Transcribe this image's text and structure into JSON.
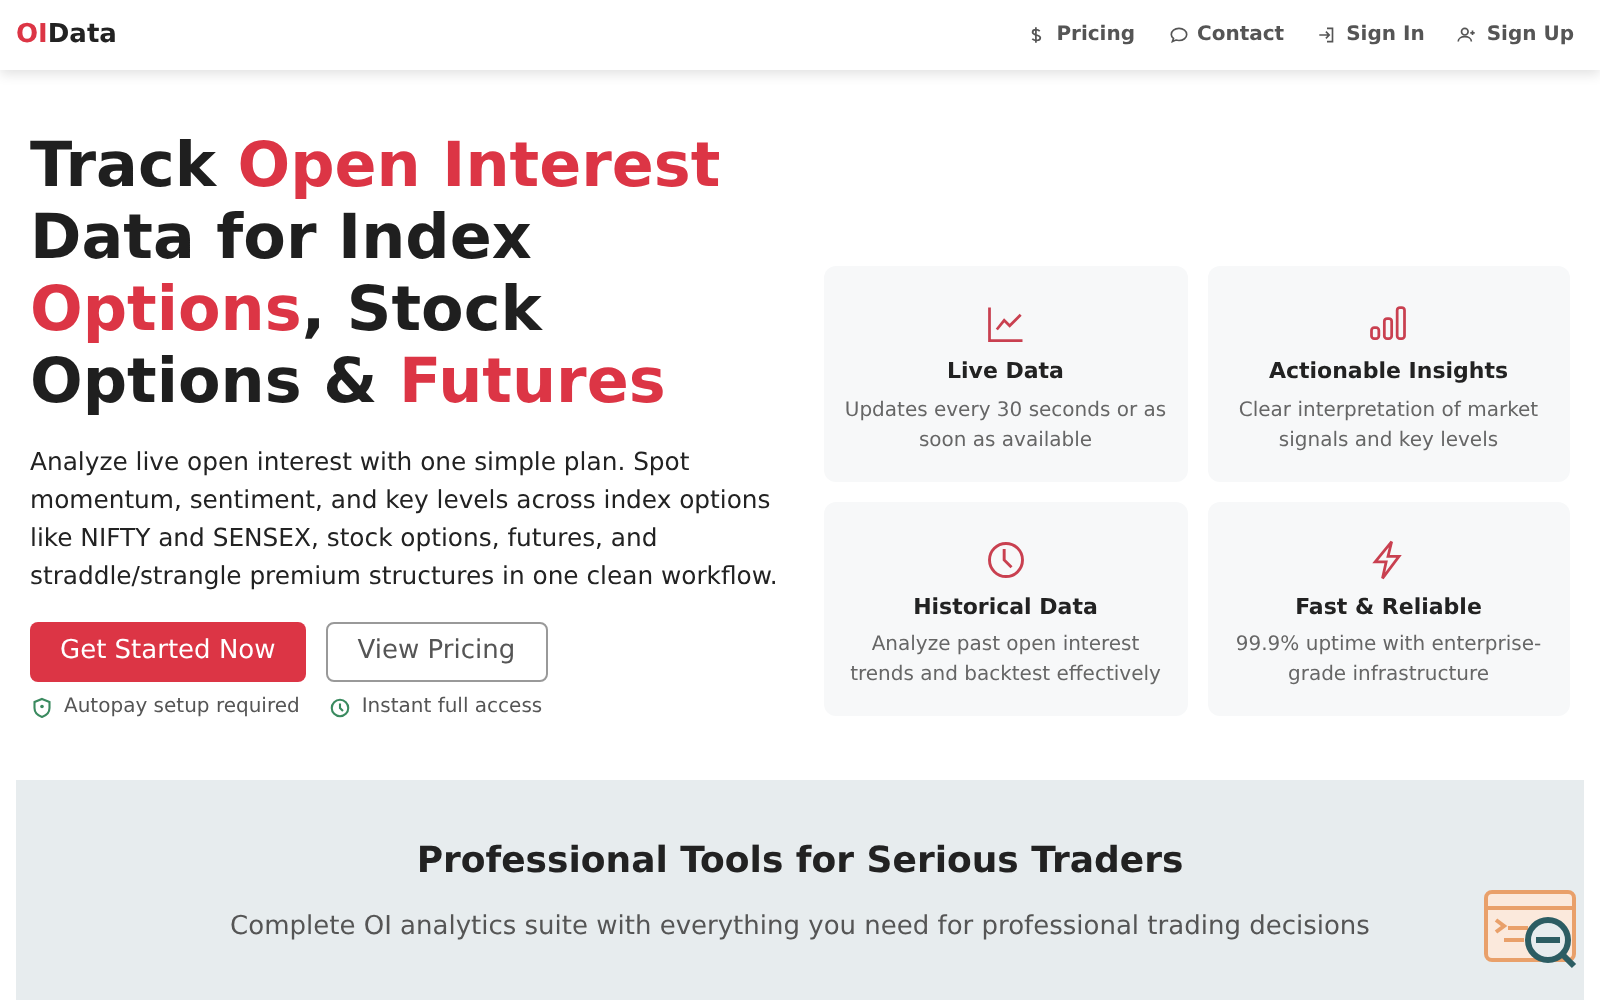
{
  "logo": {
    "accent": "OI",
    "rest": "Data"
  },
  "nav": [
    {
      "kind": "dollar",
      "label": "Pricing"
    },
    {
      "kind": "chat",
      "label": "Contact"
    },
    {
      "kind": "signin",
      "label": "Sign In"
    },
    {
      "kind": "signup",
      "label": "Sign Up"
    }
  ],
  "hero": {
    "headline": [
      {
        "text": "Track ",
        "accent": false
      },
      {
        "text": "Open Interest",
        "accent": true
      },
      {
        "text": " Data for Index ",
        "accent": false
      },
      {
        "text": "Options",
        "accent": true
      },
      {
        "text": ", Stock Options & ",
        "accent": false
      },
      {
        "text": "Futures",
        "accent": true
      }
    ],
    "description": "Analyze live open interest with one simple plan. Spot momentum, sentiment, and key levels across index options like NIFTY and SENSEX, stock options, futures, and straddle/strangle premium structures in one clean workflow.",
    "primary_button": "Get Started Now",
    "secondary_button": "View Pricing",
    "notes": [
      {
        "kind": "shield",
        "text": "Autopay setup required"
      },
      {
        "kind": "clock",
        "text": "Instant full access"
      }
    ]
  },
  "features": [
    {
      "kind": "line-chart",
      "title": "Live Data",
      "text": "Updates every 30 seconds or as soon as available"
    },
    {
      "kind": "bars",
      "title": "Actionable Insights",
      "text": "Clear interpretation of market signals and key levels"
    },
    {
      "kind": "history",
      "title": "Historical Data",
      "text": "Analyze past open interest trends and backtest effectively"
    },
    {
      "kind": "bolt",
      "title": "Fast & Reliable",
      "text": "99.9% uptime with enterprise-grade infrastructure"
    }
  ],
  "tools_section": {
    "title": "Professional Tools for Serious Traders",
    "subtitle": "Complete OI analytics suite with everything you need for professional trading decisions"
  }
}
